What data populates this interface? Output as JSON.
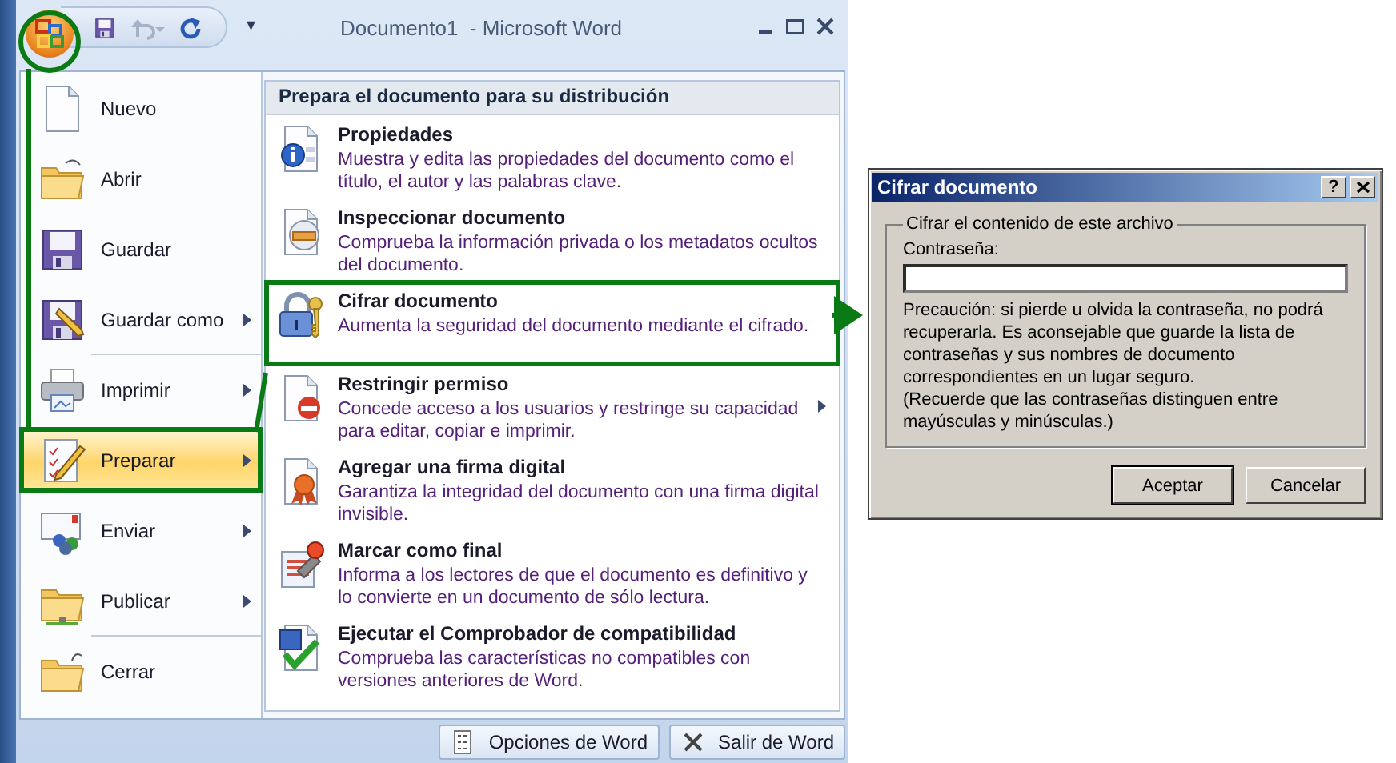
{
  "window": {
    "title": "Documento1  - Microsoft Word"
  },
  "quick_access": {
    "customize": "▾"
  },
  "menu": {
    "items": [
      {
        "label": "Nuevo",
        "kind": "new",
        "submenu": false,
        "selected": false,
        "divider_after": false
      },
      {
        "label": "Abrir",
        "kind": "open",
        "submenu": false,
        "selected": false,
        "divider_after": false
      },
      {
        "label": "Guardar",
        "kind": "save",
        "submenu": false,
        "selected": false,
        "divider_after": false
      },
      {
        "label": "Guardar como",
        "kind": "saveas",
        "submenu": true,
        "selected": false,
        "divider_after": true
      },
      {
        "label": "Imprimir",
        "kind": "print",
        "submenu": true,
        "selected": false,
        "divider_after": false
      },
      {
        "label": "Preparar",
        "kind": "prepare",
        "submenu": true,
        "selected": true,
        "divider_after": false
      },
      {
        "label": "Enviar",
        "kind": "send",
        "submenu": true,
        "selected": false,
        "divider_after": false
      },
      {
        "label": "Publicar",
        "kind": "publish",
        "submenu": true,
        "selected": false,
        "divider_after": true
      },
      {
        "label": "Cerrar",
        "kind": "close",
        "submenu": false,
        "selected": false,
        "divider_after": false
      }
    ],
    "panel": {
      "heading": "Prepara el documento para su distribución",
      "items": [
        {
          "title": "Propiedades",
          "description": "Muestra y edita las propiedades del documento como el título, el autor y las palabras clave.",
          "kind": "properties",
          "submenu": false,
          "selected": false
        },
        {
          "title": "Inspeccionar documento",
          "description": "Comprueba la información privada o los metadatos ocultos del documento.",
          "kind": "inspect",
          "submenu": false,
          "selected": false
        },
        {
          "title": "Cifrar documento",
          "description": "Aumenta la seguridad del documento mediante el cifrado.",
          "kind": "encrypt",
          "submenu": false,
          "selected": true
        },
        {
          "title": "Restringir permiso",
          "description": "Concede acceso a los usuarios y restringe su capacidad para editar, copiar e imprimir.",
          "kind": "restrict",
          "submenu": true,
          "selected": false
        },
        {
          "title": "Agregar una firma digital",
          "description": "Garantiza la integridad del documento con una firma digital invisible.",
          "kind": "signature",
          "submenu": false,
          "selected": false
        },
        {
          "title": "Marcar como final",
          "description": "Informa a los lectores de que el documento es definitivo y lo convierte en un documento de sólo lectura.",
          "kind": "final",
          "submenu": false,
          "selected": false
        },
        {
          "title": "Ejecutar el Comprobador de compatibilidad",
          "description": "Comprueba las características no compatibles con versiones anteriores de Word.",
          "kind": "compat",
          "submenu": false,
          "selected": false
        }
      ]
    },
    "footer_buttons": [
      {
        "label": "Opciones de Word",
        "kind": "options"
      },
      {
        "label": "Salir de Word",
        "kind": "exit"
      }
    ]
  },
  "dialog": {
    "title": "Cifrar documento",
    "help": "?",
    "group": "Cifrar el contenido de este archivo",
    "field_label": "Contraseña:",
    "warning": "Precaución: si pierde u olvida la contraseña, no podrá recuperarla. Es aconsejable que guarde la lista de contraseñas y sus nombres de documento correspondientes en un lugar seguro.",
    "reminder": "(Recuerde que las contraseñas distinguen entre mayúsculas y minúsculas.)",
    "buttons": [
      "Aceptar",
      "Cancelar"
    ]
  }
}
